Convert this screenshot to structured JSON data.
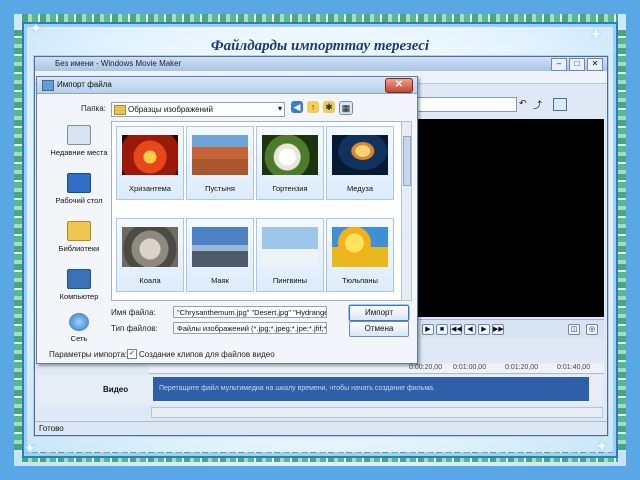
{
  "slide": {
    "title": "Файлдарды импорттау терезесі",
    "colors": {
      "frame": "#5aa7e6",
      "title": "#1b3a7a",
      "timeline": "#2e5fa8"
    }
  },
  "wmm": {
    "window_title": "Без имени - Windows Movie Maker",
    "window_controls": [
      "–",
      "□",
      "✕"
    ],
    "timeline_marks": [
      "0:00:20,00",
      "0:01:00,00",
      "0:01:20,00",
      "0:01:40,00"
    ],
    "track_label": "Видео",
    "track_hint": "Перетащите файл мультимедиа на шкалу времени, чтобы начать создание фильма.",
    "status": "Готово"
  },
  "dialog": {
    "title": "Импорт файла",
    "close_label": "✕",
    "folder_label": "Папка:",
    "folder_value": "Образцы изображений",
    "places": [
      {
        "label": "Недавние места",
        "icon": "recent-places-icon"
      },
      {
        "label": "Рабочий стол",
        "icon": "desktop-icon"
      },
      {
        "label": "Библиотеки",
        "icon": "libraries-icon"
      },
      {
        "label": "Компьютер",
        "icon": "computer-icon"
      },
      {
        "label": "Сеть",
        "icon": "network-icon"
      }
    ],
    "files": [
      {
        "name": "Хризантема",
        "thumb": "chrysanthemum"
      },
      {
        "name": "Пустыня",
        "thumb": "desert"
      },
      {
        "name": "Гортензия",
        "thumb": "hydrangeas"
      },
      {
        "name": "Медуза",
        "thumb": "jellyfish"
      },
      {
        "name": "Коала",
        "thumb": "koala"
      },
      {
        "name": "Маяк",
        "thumb": "lighthouse"
      },
      {
        "name": "Пингвины",
        "thumb": "penguins"
      },
      {
        "name": "Тюльпаны",
        "thumb": "tulips"
      }
    ],
    "filename_label": "Имя файла:",
    "filename_value": "\"Chrysanthemum.jpg\" \"Desert.jpg\" \"Hydrangeas",
    "filetype_label": "Тип файлов:",
    "filetype_value": "Файлы изображений (*.jpg;*.jpeg;*.jpe;*.jfif;*.gif",
    "import_button": "Импорт",
    "cancel_button": "Отмена",
    "options_label": "Параметры импорта:",
    "checkbox_label": "Создание клипов для файлов видео",
    "checkbox_checked": true
  }
}
